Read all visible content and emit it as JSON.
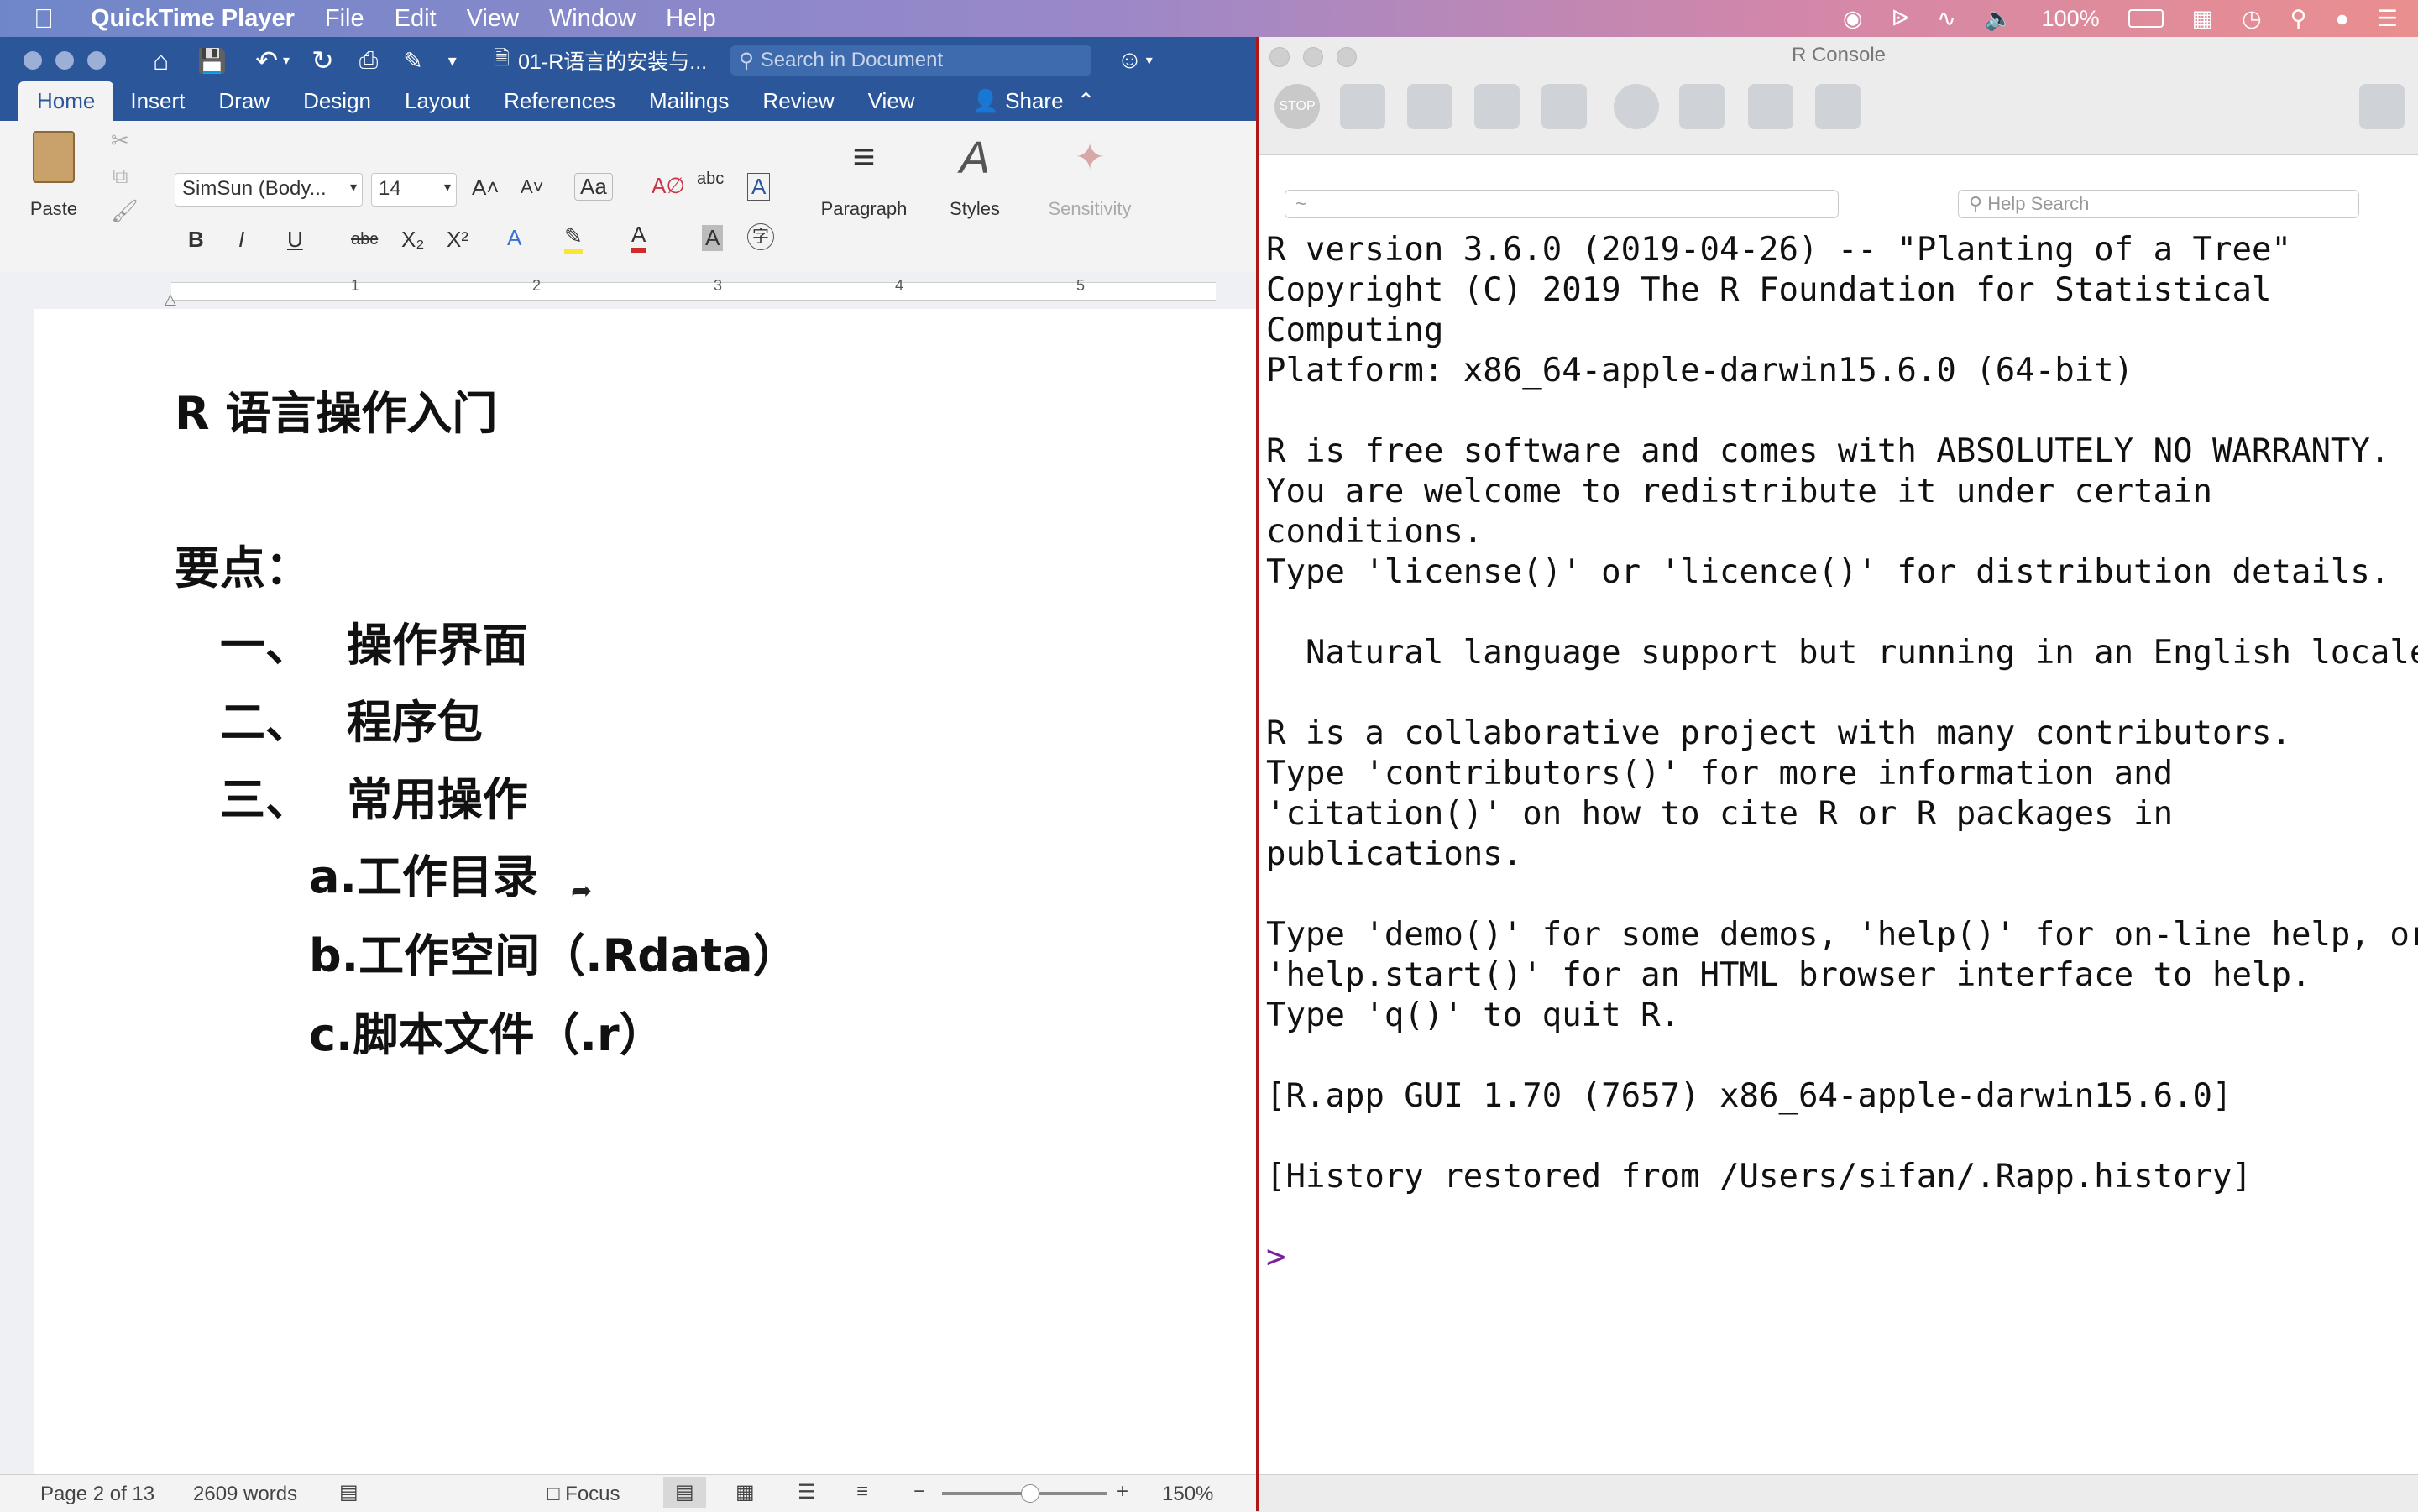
{
  "menubar": {
    "app_name": "QuickTime Player",
    "items": [
      "File",
      "Edit",
      "View",
      "Window",
      "Help"
    ],
    "battery": "100%"
  },
  "word": {
    "doc_title": "01-R语言的安装与...",
    "search_placeholder": "Search in Document",
    "tabs": [
      "Home",
      "Insert",
      "Draw",
      "Design",
      "Layout",
      "References",
      "Mailings",
      "Review",
      "View"
    ],
    "share_label": "Share",
    "ribbon": {
      "paste": "Paste",
      "font_name": "SimSun (Body...",
      "font_size": "14",
      "paragraph": "Paragraph",
      "styles": "Styles",
      "sensitivity": "Sensitivity"
    },
    "ruler_numbers": [
      "1",
      "2",
      "3",
      "4",
      "5"
    ],
    "document": {
      "title": "R 语言操作入门",
      "keypoints": "要点：",
      "items": [
        {
          "num": "一、",
          "text": "操作界面"
        },
        {
          "num": "二、",
          "text": "程序包"
        },
        {
          "num": "三、",
          "text": "常用操作"
        }
      ],
      "subitems": [
        {
          "label": "a.",
          "text": "工作目录"
        },
        {
          "label": "b.",
          "text": "工作空间（.Rdata）"
        },
        {
          "label": "c.",
          "text": "脚本文件（.r）"
        }
      ]
    },
    "status": {
      "page": "Page 2 of 13",
      "words": "2609 words",
      "focus": "Focus",
      "zoom": "150%"
    }
  },
  "rconsole": {
    "title": "R Console",
    "path": "~",
    "help_placeholder": "Help Search",
    "output_lines": [
      "R version 3.6.0 (2019-04-26) -- \"Planting of a Tree\"",
      "Copyright (C) 2019 The R Foundation for Statistical",
      "Computing",
      "Platform: x86_64-apple-darwin15.6.0 (64-bit)",
      "",
      "R is free software and comes with ABSOLUTELY NO WARRANTY.",
      "You are welcome to redistribute it under certain",
      "conditions.",
      "Type 'license()' or 'licence()' for distribution details.",
      "",
      "  Natural language support but running in an English locale",
      "",
      "R is a collaborative project with many contributors.",
      "Type 'contributors()' for more information and",
      "'citation()' on how to cite R or R packages in",
      "publications.",
      "",
      "Type 'demo()' for some demos, 'help()' for on-line help, or",
      "'help.start()' for an HTML browser interface to help.",
      "Type 'q()' to quit R.",
      "",
      "[R.app GUI 1.70 (7657) x86_64-apple-darwin15.6.0]",
      "",
      "[History restored from /Users/sifan/.Rapp.history]",
      ""
    ],
    "prompt": ">",
    "stop_label": "STOP"
  }
}
